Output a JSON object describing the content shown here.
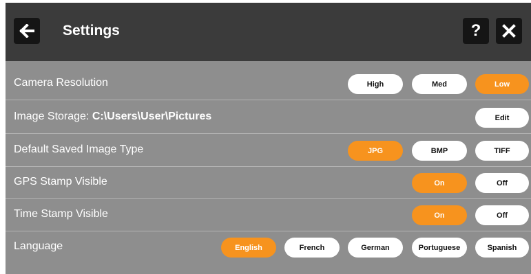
{
  "header": {
    "title": "Settings",
    "back_icon": "arrow-left-icon",
    "help_label": "?",
    "close_icon": "close-icon"
  },
  "colors": {
    "header_bg": "#3b3b3b",
    "panel_bg": "#8e8e8e",
    "accent": "#f7931e",
    "pill_bg": "#ffffff"
  },
  "rows": {
    "camera_resolution": {
      "label": "Camera Resolution",
      "options": [
        "High",
        "Med",
        "Low"
      ],
      "selected": "Low"
    },
    "image_storage": {
      "label": "Image Storage:",
      "value": "C:\\Users\\User\\Pictures",
      "edit_label": "Edit"
    },
    "image_type": {
      "label": "Default Saved Image Type",
      "options": [
        "JPG",
        "BMP",
        "TIFF"
      ],
      "selected": "JPG"
    },
    "gps_stamp": {
      "label": "GPS Stamp Visible",
      "options": [
        "On",
        "Off"
      ],
      "selected": "On"
    },
    "time_stamp": {
      "label": "Time Stamp Visible",
      "options": [
        "On",
        "Off"
      ],
      "selected": "On"
    },
    "language": {
      "label": "Language",
      "options": [
        "English",
        "French",
        "German",
        "Portuguese",
        "Spanish"
      ],
      "selected": "English"
    }
  }
}
